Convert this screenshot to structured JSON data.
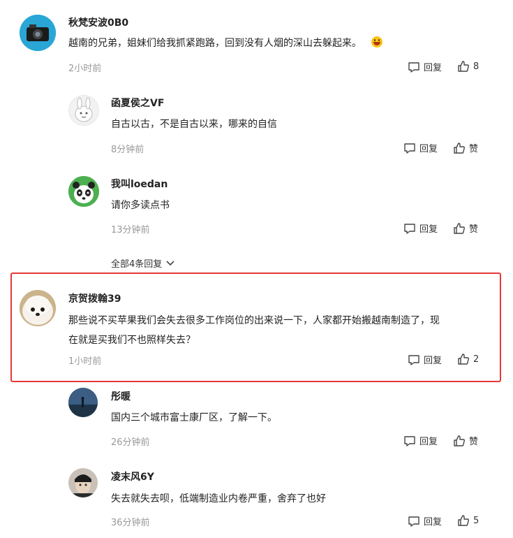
{
  "actions": {
    "reply_label": "回复",
    "like_label_default": "赞"
  },
  "comments": [
    {
      "user": "秋梵安波0B0",
      "text": "越南的兄弟，姐妹们给我抓紧跑路，回到没有人烟的深山去躲起来。",
      "time": "2小时前",
      "likes": "8"
    },
    {
      "user": "函夏侯之VF",
      "text": "自古以古，不是自古以来，哪来的自信",
      "time": "8分钟前",
      "likes": "赞"
    },
    {
      "user": "我叫loedan",
      "text": "请你多读点书",
      "time": "13分钟前",
      "likes": "赞"
    },
    {
      "user": "京贺拨翰39",
      "text_line1": "那些说不买苹果我们会失去很多工作岗位的出来说一下，人家都开始搬越南制造了，现",
      "text_line2": "在就是买我们不也照样失去？",
      "time": "1小时前",
      "likes": "2"
    },
    {
      "user": "彤暖",
      "text": "国内三个城市富士康厂区，了解一下。",
      "time": "26分钟前",
      "likes": "赞"
    },
    {
      "user": "凌末风6Y",
      "text": "失去就失去呗，低端制造业内卷严重，舍弃了也好",
      "time": "36分钟前",
      "likes": "5"
    }
  ],
  "more_replies": "全部4条回复",
  "colors": {
    "highlight": "#e53935",
    "time": "#999999",
    "text": "#222222"
  }
}
